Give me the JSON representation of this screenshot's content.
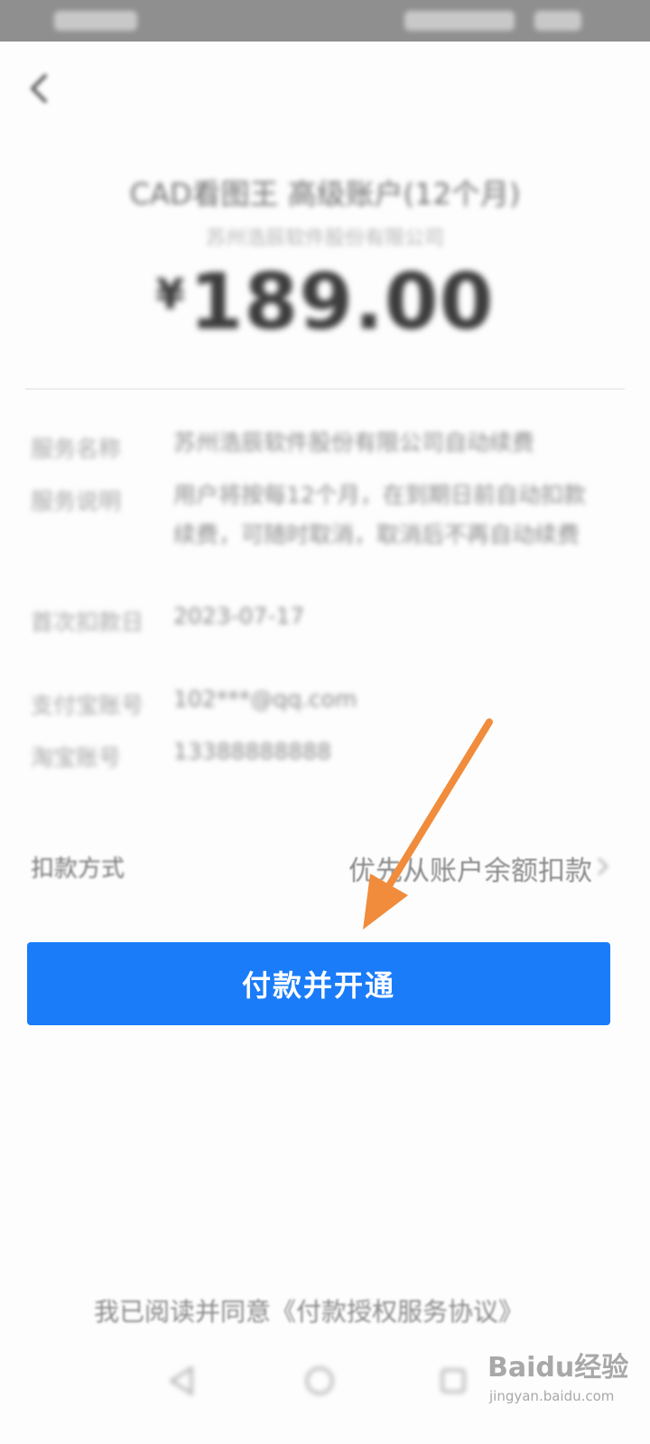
{
  "status_bar": {},
  "product": {
    "title": "CAD看图王 高级账户(12个月)",
    "merchant": "苏州浩辰软件股份有限公司"
  },
  "amount": {
    "currency_symbol": "¥",
    "value": "189.00"
  },
  "details": [
    {
      "label": "服务名称",
      "value": "苏州浩辰软件股份有限公司自动续费"
    },
    {
      "label": "服务说明",
      "value": "用户将按每12个月，在到期日前自动扣款续费，可随时取消，取消后不再自动续费"
    },
    {
      "label": "首次扣款日",
      "value": "2023-07-17"
    },
    {
      "label": "支付宝账号",
      "value": "102***@qq.com"
    },
    {
      "label": "淘宝账号",
      "value": "13388888888"
    }
  ],
  "payment_method": {
    "label": "扣款方式",
    "value": "优先从账户余额扣款"
  },
  "pay_button": {
    "label": "付款并开通"
  },
  "agreement": {
    "text": "我已阅读并同意《付款授权服务协议》"
  },
  "watermark": {
    "logo_text": "Baidu经验",
    "url": "jingyan.baidu.com"
  },
  "colors": {
    "primary_button": "#1a7cf9",
    "annotation_arrow": "#f08c3c"
  },
  "icons": {
    "back": "back-chevron-icon",
    "payment_chevron": "chevron-right-icon",
    "nav_back": "nav-back-icon",
    "nav_home": "nav-home-icon",
    "nav_recent": "nav-recent-icon"
  }
}
